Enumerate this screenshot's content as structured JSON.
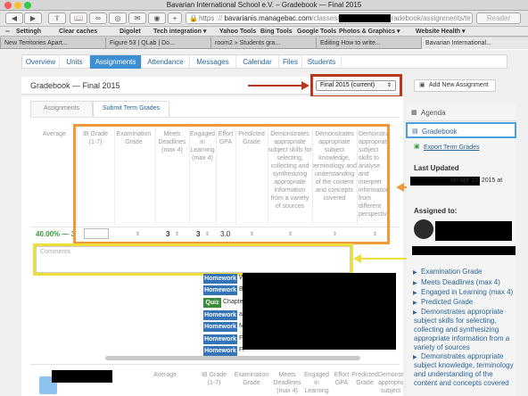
{
  "window": {
    "title": "Bavarian International School e.V. – Gradebook — Final 2015"
  },
  "toolbar": {
    "url_host": "bavarianis.managebac.com",
    "url_path": "/classes/",
    "url_tail": "radebook/assignments/te",
    "url_prefix": "https",
    "reader": "Reader"
  },
  "bookmarks": [
    "Settingh",
    "Clear caches",
    "Digolet",
    "Tech integration ▾",
    "Yahoo Tools",
    "Bing Tools",
    "Google Tools",
    "Photos & Graphics ▾",
    "Website Health ▾"
  ],
  "browser_tabs": [
    "New Territories Apart...",
    "Figure 53 | QLab | Do...",
    "room2 » Students gra...",
    "Editing How to write...",
    "Bavarian International..."
  ],
  "nav_tabs": [
    "Overview",
    "Units",
    "Assignments",
    "Attendance",
    "Messages",
    "Calendar",
    "Files",
    "Students"
  ],
  "gradebook": {
    "title": "Gradebook — Final 2015",
    "term_select": "Final 2015 (current)",
    "add_button": "Add New Assignment"
  },
  "sub_tabs": [
    "Assignments",
    "Submit Term Grades"
  ],
  "grade_table": {
    "headers": {
      "average": "Average",
      "ib": "IB Grade (1-7)",
      "exam": "Examination Grade",
      "deadlines": "Meets Deadlines (max 4)",
      "engaged": "Engaged in Learning (max 4)",
      "effort": "Effort GPA",
      "predicted": "Predicted Grade",
      "crit1": "Demonstrates appropriate subject skills for selecting, collecting and synthesizing appropriate information from a variety of sources",
      "crit2": "Demonstrates appropriate subject knowledge, terminology and understanding of the content and concepts covered",
      "crit3": "Demonstrates appropriate subject skills to analyse and interpret information from different perspectives"
    },
    "row": {
      "average": "40.00% — 3",
      "deadlines": "3",
      "engaged": "3",
      "effort": "3.0"
    },
    "comments_label": "Comments"
  },
  "assignment_tags": [
    {
      "type": "Homework",
      "kind": "hw",
      "text": "W"
    },
    {
      "type": "Homework",
      "kind": "hw",
      "text": "Bi"
    },
    {
      "type": "Quiz",
      "kind": "qz",
      "text": "Chapter"
    },
    {
      "type": "Homework",
      "kind": "hw",
      "text": "as"
    },
    {
      "type": "Homework",
      "kind": "hw",
      "text": "M"
    },
    {
      "type": "Homework",
      "kind": "hw",
      "text": "Fi"
    },
    {
      "type": "Homework",
      "kind": "hw",
      "text": "Fi"
    }
  ],
  "footer_row_headers": {
    "average": "Average",
    "ib": "IB Grade (1-7)",
    "exam": "Examination Grade",
    "deadlines": "Meets Deadlines (max 4)",
    "engaged": "Engaged in Learning",
    "effort": "Effort GPA",
    "predicted": "Predicted Grade",
    "crit1": "Demonstrates appropriate subject",
    "crit2": "Demonstrates appropriate subject knowledge"
  },
  "sidebar": {
    "agenda": "Agenda",
    "gradebook": "Gradebook",
    "export": "Export Term Grades",
    "last_updated_label": "Last Updated",
    "last_updated_value": "on Apr 16, 2015 at",
    "assigned_label": "Assigned to:",
    "criteria": [
      "Examination Grade",
      "Meets Deadlines (max 4)",
      "Engaged in Learning (max 4)",
      "Predicted Grade",
      "Demonstrates appropriate subject skills for selecting, collecting and synthesizing appropriate information from a variety of sources",
      "Demonstrates appropriate subject knowledge, terminology and understanding of the content and concepts covered"
    ]
  },
  "colors": {
    "annotation_red": "#b5381f",
    "annotation_orange": "#ef9a3a",
    "annotation_yellow": "#eede3a",
    "active_tab": "#3d8fd1",
    "green_average": "#3a9a3a"
  }
}
